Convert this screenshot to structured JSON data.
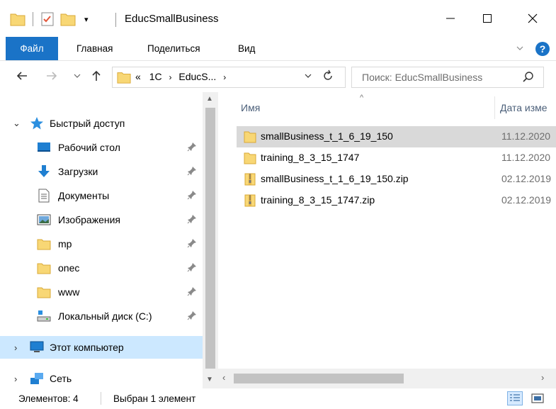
{
  "window": {
    "title": "EducSmallBusiness"
  },
  "ribbon": {
    "tabs": [
      {
        "label": "Файл"
      },
      {
        "label": "Главная"
      },
      {
        "label": "Поделиться"
      },
      {
        "label": "Вид"
      }
    ],
    "help_label": "?"
  },
  "address": {
    "overflow": "«",
    "crumb1": "1C",
    "crumb2": "EducS...",
    "search_placeholder": "Поиск: EducSmallBusiness"
  },
  "nav": {
    "quick_access": "Быстрый доступ",
    "items": [
      {
        "label": "Рабочий стол",
        "icon": "desktop-icon"
      },
      {
        "label": "Загрузки",
        "icon": "downloads-icon"
      },
      {
        "label": "Документы",
        "icon": "documents-icon"
      },
      {
        "label": "Изображения",
        "icon": "pictures-icon"
      },
      {
        "label": "mp",
        "icon": "folder-icon"
      },
      {
        "label": "onec",
        "icon": "folder-icon"
      },
      {
        "label": "www",
        "icon": "folder-icon"
      },
      {
        "label": "Локальный диск (C:)",
        "icon": "drive-icon"
      }
    ],
    "this_pc": "Этот компьютер",
    "network": "Сеть"
  },
  "content": {
    "columns": {
      "name": "Имя",
      "date": "Дата изме"
    },
    "files": [
      {
        "name": "smallBusiness_t_1_6_19_150",
        "date": "11.12.2020",
        "type": "folder",
        "selected": true
      },
      {
        "name": "training_8_3_15_1747",
        "date": "11.12.2020",
        "type": "folder",
        "selected": false
      },
      {
        "name": "smallBusiness_t_1_6_19_150.zip",
        "date": "02.12.2019",
        "type": "zip",
        "selected": false
      },
      {
        "name": "training_8_3_15_1747.zip",
        "date": "02.12.2019",
        "type": "zip",
        "selected": false
      }
    ]
  },
  "status": {
    "count": "Элементов: 4",
    "selection": "Выбран 1 элемент"
  },
  "colors": {
    "accent": "#1a73c7",
    "selection": "#cce8ff",
    "folder": "#f8d775"
  }
}
